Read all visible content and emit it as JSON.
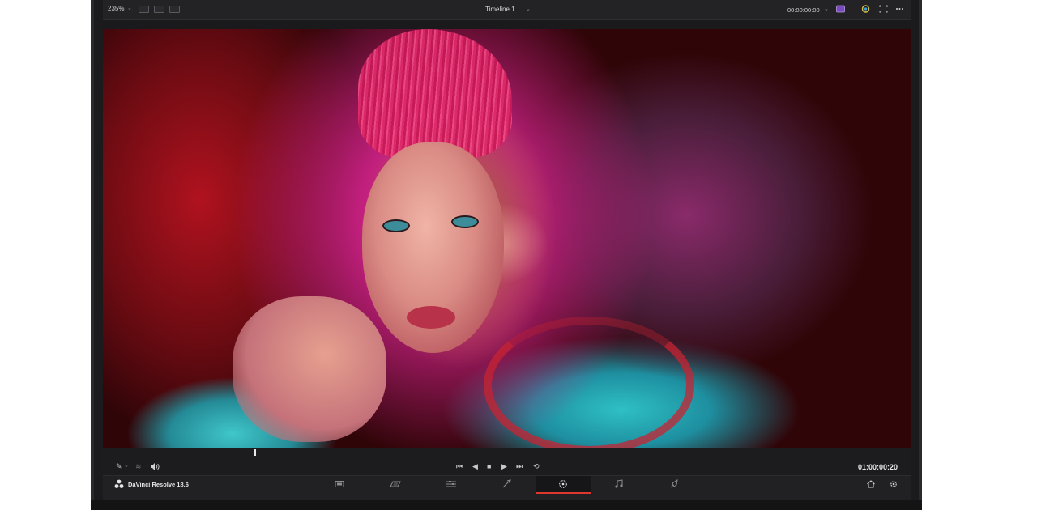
{
  "viewer_toolbar": {
    "zoom_label": "235%",
    "timeline_name": "Timeline 1",
    "timecode": "00:00:00:00"
  },
  "transport": {
    "timecode": "01:00:00:20",
    "playhead_fraction": 0.18
  },
  "footer": {
    "app_name": "DaVinci Resolve 18.6",
    "pages": [
      "media",
      "cut",
      "edit",
      "fusion",
      "color",
      "fairlight",
      "deliver"
    ],
    "active_page": "color"
  },
  "colors": {
    "accent": "#e0372c",
    "panel": "#1e1e20",
    "text": "#d0d0d3"
  }
}
